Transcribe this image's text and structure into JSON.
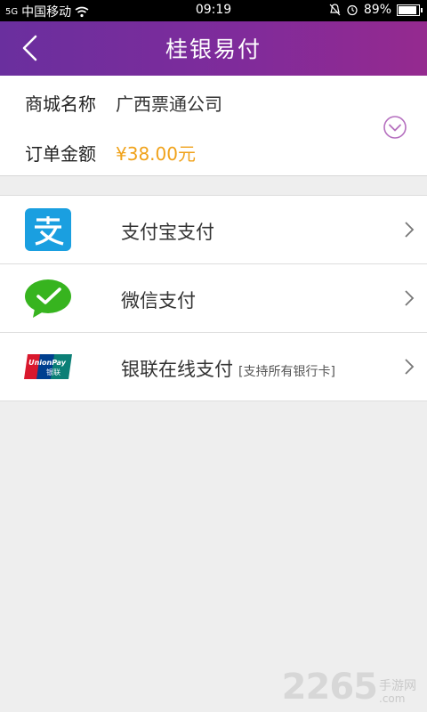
{
  "status_bar": {
    "signal": "5G",
    "carrier": "中国移动",
    "time": "09:19",
    "battery": "89%",
    "battery_level": 0.89
  },
  "header": {
    "title": "桂银易付"
  },
  "order": {
    "merchant_label": "商城名称",
    "merchant_value": "广西票通公司",
    "amount_label": "订单金额",
    "amount_value": "¥38.00元"
  },
  "payment_methods": [
    {
      "label": "支付宝支付",
      "note": "",
      "icon": "alipay-logo"
    },
    {
      "label": "微信支付",
      "note": "",
      "icon": "wechat-logo"
    },
    {
      "label": "银联在线支付",
      "note": "[支持所有银行卡]",
      "icon": "unionpay-logo"
    }
  ],
  "watermark": {
    "number": "2265",
    "text_cn": "手游网",
    "text_en": ".com"
  },
  "colors": {
    "header_start": "#6a2f9e",
    "header_end": "#952a8f",
    "amount": "#f0a21a",
    "alipay": "#1a9fe0",
    "wechat": "#37b41f",
    "expand_icon": "#b56fbf"
  }
}
